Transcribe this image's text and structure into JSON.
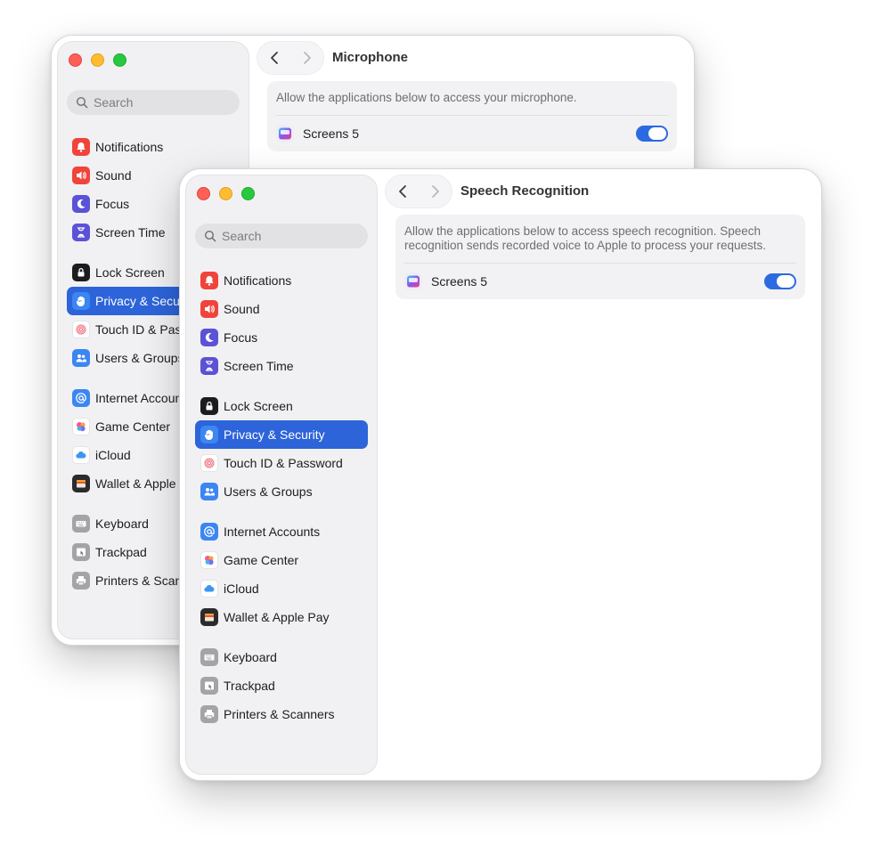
{
  "colors": {
    "accent": "#2d64d9",
    "toggle_on": "#2c6ae1"
  },
  "back_window": {
    "title": "Microphone",
    "search_placeholder": "Search",
    "description": "Allow the applications below to access your microphone.",
    "apps": [
      {
        "name": "Screens 5",
        "enabled": true
      }
    ],
    "sidebar": [
      {
        "label": "Notifications",
        "icon": "notifications-icon"
      },
      {
        "label": "Sound",
        "icon": "sound-icon"
      },
      {
        "label": "Focus",
        "icon": "focus-moon-icon"
      },
      {
        "label": "Screen Time",
        "icon": "hourglass-icon"
      },
      {
        "label": "Lock Screen",
        "icon": "lock-icon"
      },
      {
        "label": "Privacy & Secur",
        "icon": "hand-icon",
        "selected": true
      },
      {
        "label": "Touch ID & Pass",
        "icon": "fingerprint-icon"
      },
      {
        "label": "Users & Groups",
        "icon": "users-icon"
      },
      {
        "label": "Internet Accoun",
        "icon": "at-sign-icon"
      },
      {
        "label": "Game Center",
        "icon": "game-center-icon"
      },
      {
        "label": "iCloud",
        "icon": "cloud-icon"
      },
      {
        "label": "Wallet & Apple I",
        "icon": "wallet-icon"
      },
      {
        "label": "Keyboard",
        "icon": "keyboard-icon"
      },
      {
        "label": "Trackpad",
        "icon": "trackpad-icon"
      },
      {
        "label": "Printers & Scann",
        "icon": "printer-icon"
      }
    ]
  },
  "front_window": {
    "title": "Speech Recognition",
    "search_placeholder": "Search",
    "description": "Allow the applications below to access speech recognition. Speech recognition sends recorded voice to Apple to process your requests.",
    "apps": [
      {
        "name": "Screens 5",
        "enabled": true
      }
    ],
    "sidebar": [
      {
        "label": "Notifications",
        "icon": "notifications-icon"
      },
      {
        "label": "Sound",
        "icon": "sound-icon"
      },
      {
        "label": "Focus",
        "icon": "focus-moon-icon"
      },
      {
        "label": "Screen Time",
        "icon": "hourglass-icon"
      },
      {
        "label": "Lock Screen",
        "icon": "lock-icon"
      },
      {
        "label": "Privacy & Security",
        "icon": "hand-icon",
        "selected": true
      },
      {
        "label": "Touch ID & Password",
        "icon": "fingerprint-icon"
      },
      {
        "label": "Users & Groups",
        "icon": "users-icon"
      },
      {
        "label": "Internet Accounts",
        "icon": "at-sign-icon"
      },
      {
        "label": "Game Center",
        "icon": "game-center-icon"
      },
      {
        "label": "iCloud",
        "icon": "cloud-icon"
      },
      {
        "label": "Wallet & Apple Pay",
        "icon": "wallet-icon"
      },
      {
        "label": "Keyboard",
        "icon": "keyboard-icon"
      },
      {
        "label": "Trackpad",
        "icon": "trackpad-icon"
      },
      {
        "label": "Printers & Scanners",
        "icon": "printer-icon"
      }
    ]
  }
}
